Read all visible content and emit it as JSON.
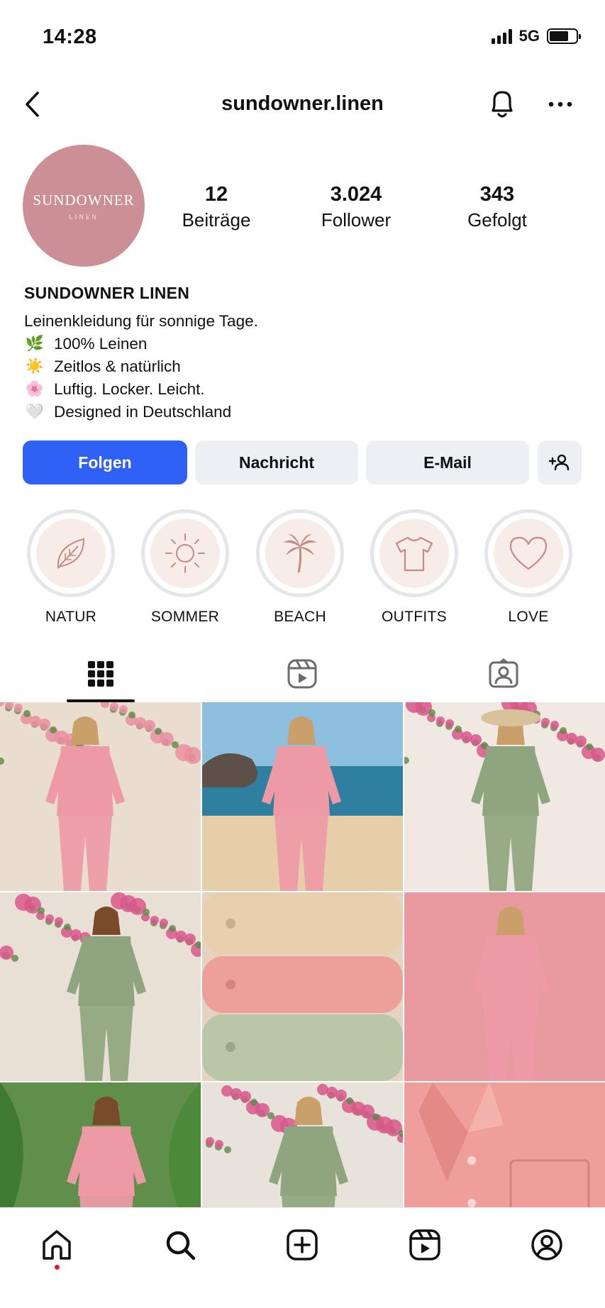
{
  "status_bar": {
    "time": "14:28",
    "network": "5G"
  },
  "header": {
    "username": "sundowner.linen"
  },
  "profile": {
    "avatar": {
      "brand": "SUNDOWNER",
      "sub": "LINEN",
      "color": "#cc8f95"
    },
    "stats": [
      {
        "value": "12",
        "label": "Beiträge"
      },
      {
        "value": "3.024",
        "label": "Follower"
      },
      {
        "value": "343",
        "label": "Gefolgt"
      }
    ],
    "name": "SUNDOWNER LINEN",
    "bio": [
      {
        "emoji": "",
        "text": "Leinenkleidung für sonnige Tage."
      },
      {
        "emoji": "🌿",
        "text": "100% Leinen"
      },
      {
        "emoji": "☀️",
        "text": "Zeitlos & natürlich"
      },
      {
        "emoji": "🌸",
        "text": "Luftig. Locker. Leicht."
      },
      {
        "emoji": "🤍",
        "text": "Designed in Deutschland"
      }
    ]
  },
  "actions": {
    "follow": "Folgen",
    "message": "Nachricht",
    "email": "E-Mail"
  },
  "highlights": [
    {
      "label": "NATUR",
      "icon": "leaf-icon"
    },
    {
      "label": "SOMMER",
      "icon": "sun-icon"
    },
    {
      "label": "BEACH",
      "icon": "palm-tree-icon"
    },
    {
      "label": "OUTFITS",
      "icon": "tshirt-icon"
    },
    {
      "label": "LOVE",
      "icon": "heart-icon"
    }
  ],
  "tabs": [
    {
      "name": "grid-tab",
      "icon": "grid-icon",
      "active": true
    },
    {
      "name": "reels-tab",
      "icon": "reels-icon",
      "active": false
    },
    {
      "name": "tagged-tab",
      "icon": "tagged-user-icon",
      "active": false
    }
  ],
  "posts": [
    {
      "bg": "#e9ddd0",
      "accent": "#eb8ea0",
      "flowers": true,
      "outfit": "pink"
    },
    {
      "bg": "#7fb3d4",
      "accent": "#e8c99c",
      "flowers": false,
      "outfit": "pink"
    },
    {
      "bg": "#efe9e1",
      "accent": "#d9578b",
      "flowers": true,
      "outfit": "green"
    },
    {
      "bg": "#e8e0d4",
      "accent": "#d9578b",
      "flowers": true,
      "outfit": "green"
    },
    {
      "bg": "#e4d3c0",
      "accent": "#efa29a",
      "flowers": false,
      "outfit": "folded"
    },
    {
      "bg": "#e99aa0",
      "accent": "#c8876f",
      "flowers": false,
      "outfit": "pink"
    },
    {
      "bg": "#5f8f4a",
      "accent": "#f1b0a9",
      "flowers": false,
      "outfit": "pink"
    },
    {
      "bg": "#e8e3da",
      "accent": "#d9578b",
      "flowers": true,
      "outfit": "green"
    },
    {
      "bg": "#eda29d",
      "accent": "#e38c8a",
      "flowers": false,
      "outfit": "closeup"
    }
  ],
  "colors": {
    "primary_button": "#2f61f6",
    "secondary_button": "#eeeff2",
    "notification_dot": "#e5173f"
  }
}
